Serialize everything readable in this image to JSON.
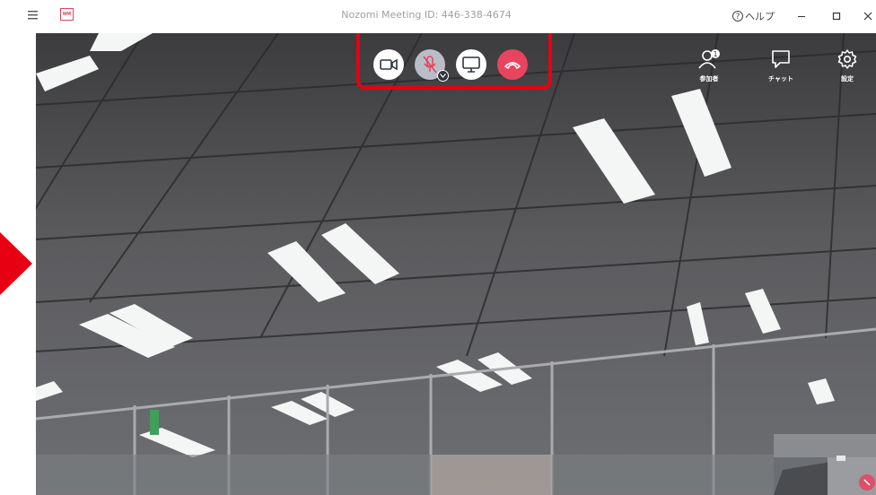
{
  "titlebar": {
    "logo_text": "NM",
    "title": "Nozomi Meeting ID: 446-338-4674",
    "help_label": "ヘルプ",
    "help_icon": "question-circle-icon",
    "controls": [
      "minimize-icon",
      "maximize-icon",
      "close-icon"
    ]
  },
  "meeting": {
    "controls": [
      {
        "name": "camera",
        "icon": "video-camera-icon"
      },
      {
        "name": "microphone",
        "icon": "mic-muted-icon",
        "state": "muted"
      },
      {
        "name": "screen-share",
        "icon": "monitor-icon"
      },
      {
        "name": "hang-up",
        "icon": "phone-hangup-icon"
      }
    ],
    "tools": {
      "participants_label": "参加者",
      "chat_label": "チャット",
      "settings_label": "設定"
    }
  },
  "colors": {
    "hangup": "#e8435f",
    "highlight": "#e60012",
    "arrow": "#e60012",
    "mic_muted_bg": "#b9bdc8"
  }
}
